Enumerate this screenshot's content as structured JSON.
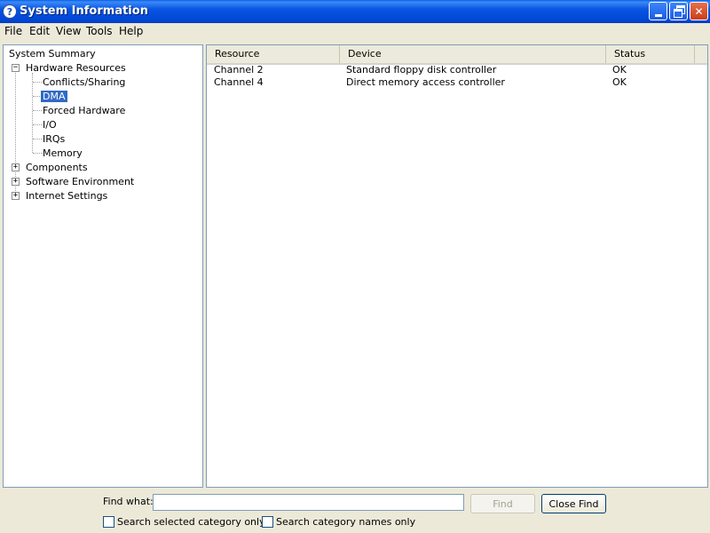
{
  "window": {
    "title": "System Information",
    "app_icon": "help-question-icon"
  },
  "menu": [
    "File",
    "Edit",
    "View",
    "Tools",
    "Help"
  ],
  "tree": {
    "root": "System Summary",
    "hardware": "Hardware Resources",
    "hardware_children": [
      "Conflicts/Sharing",
      "DMA",
      "Forced Hardware",
      "I/O",
      "IRQs",
      "Memory"
    ],
    "selected": "DMA",
    "collapsed": [
      "Components",
      "Software Environment",
      "Internet Settings"
    ],
    "expand_glyph": "+",
    "collapse_glyph": "−"
  },
  "table": {
    "columns": [
      "Resource",
      "Device",
      "Status"
    ],
    "rows": [
      [
        "Channel 2",
        "Standard floppy disk controller",
        "OK"
      ],
      [
        "Channel 4",
        "Direct memory access controller",
        "OK"
      ]
    ]
  },
  "find": {
    "label": "Find what:",
    "value": "",
    "find_button": "Find",
    "close_button": "Close Find",
    "check_selected": "Search selected category only",
    "check_names": "Search category names only"
  },
  "colors": {
    "title_bar": "#0a55e1",
    "selection": "#316ac5",
    "face": "#ece9d8"
  }
}
